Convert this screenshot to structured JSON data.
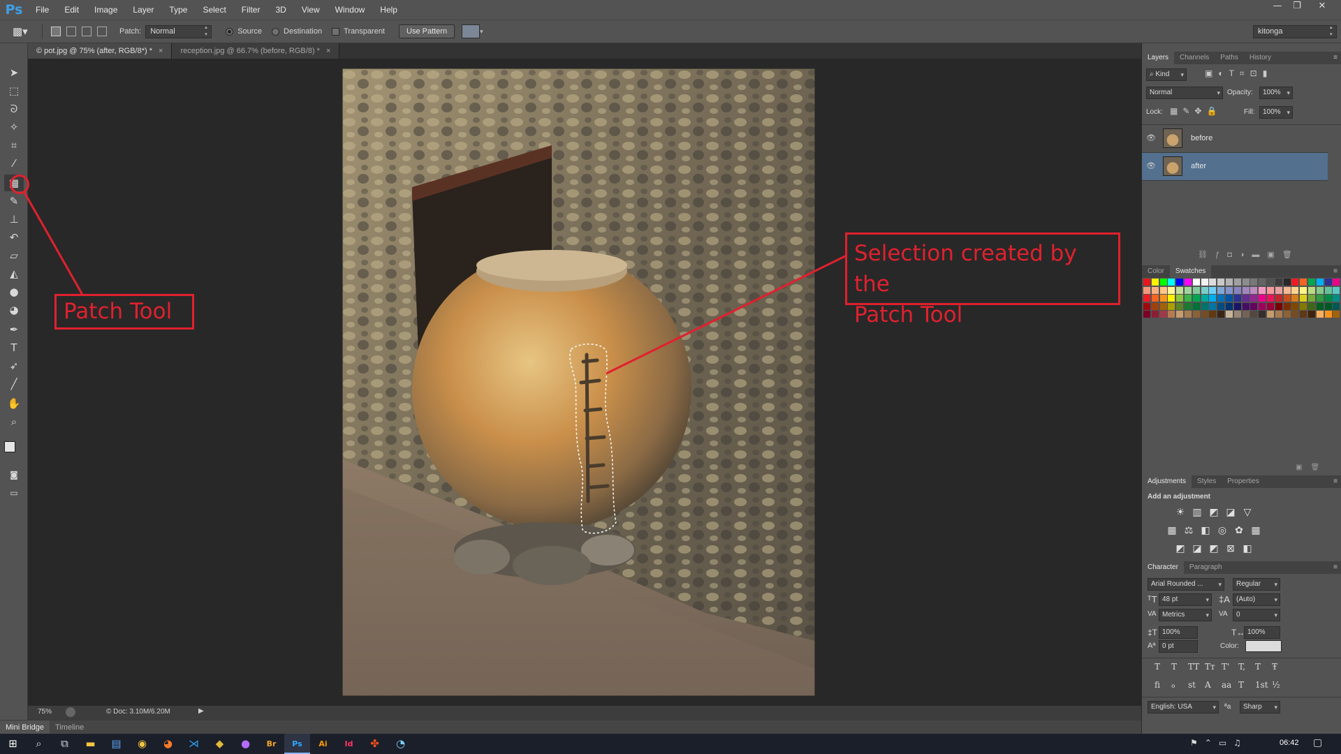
{
  "app": {
    "logo": "Ps",
    "menu": [
      "File",
      "Edit",
      "Image",
      "Layer",
      "Type",
      "Select",
      "Filter",
      "3D",
      "View",
      "Window",
      "Help"
    ],
    "window_controls": [
      "—",
      "❐",
      "✕"
    ]
  },
  "options_bar": {
    "patch_label": "Patch:",
    "patch_mode": "Normal",
    "source_label": "Source",
    "destination_label": "Destination",
    "transparent_label": "Transparent",
    "use_pattern_label": "Use Pattern",
    "workspace": "kitonga",
    "source_selected": true
  },
  "document_tabs": [
    {
      "label": "© pot.jpg @ 75% (after, RGB/8*) *",
      "active": true
    },
    {
      "label": "reception.jpg @ 66.7% (before, RGB/8) *",
      "active": false
    }
  ],
  "toolbar": {
    "active_tool": "patch-tool",
    "tools": [
      {
        "name": "move-tool",
        "glyph": "➤"
      },
      {
        "name": "marquee-tool",
        "glyph": "⬚"
      },
      {
        "name": "lasso-tool",
        "glyph": "ᘐ"
      },
      {
        "name": "magic-wand-tool",
        "glyph": "✧"
      },
      {
        "name": "crop-tool",
        "glyph": "⌗"
      },
      {
        "name": "eyedropper-tool",
        "glyph": "⁄"
      },
      {
        "name": "patch-tool",
        "glyph": "▩"
      },
      {
        "name": "brush-tool",
        "glyph": "✎"
      },
      {
        "name": "clone-stamp-tool",
        "glyph": "⊥"
      },
      {
        "name": "history-brush-tool",
        "glyph": "↶"
      },
      {
        "name": "eraser-tool",
        "glyph": "▱"
      },
      {
        "name": "paint-bucket-tool",
        "glyph": "◭"
      },
      {
        "name": "blur-tool",
        "glyph": "●"
      },
      {
        "name": "dodge-tool",
        "glyph": "◕"
      },
      {
        "name": "pen-tool",
        "glyph": "✒"
      },
      {
        "name": "type-tool",
        "glyph": "T"
      },
      {
        "name": "path-selection-tool",
        "glyph": "➶"
      },
      {
        "name": "line-tool",
        "glyph": "╱"
      },
      {
        "name": "hand-tool",
        "glyph": "✋"
      },
      {
        "name": "zoom-tool",
        "glyph": "🔍"
      }
    ]
  },
  "status_bar": {
    "zoom": "75%",
    "doc_info": "© Doc: 3.10M/6.20M"
  },
  "bottom_tabs": [
    "Mini Bridge",
    "Timeline"
  ],
  "layers_panel": {
    "tabs": [
      "Layers",
      "Channels",
      "Paths",
      "History"
    ],
    "filter_kind": "Kind",
    "blend_mode": "Normal",
    "opacity_label": "Opacity:",
    "opacity_value": "100%",
    "lock_label": "Lock:",
    "fill_label": "Fill:",
    "fill_value": "100%",
    "layers": [
      {
        "name": "before",
        "selected": false
      },
      {
        "name": "after",
        "selected": true
      }
    ]
  },
  "swatches_panel": {
    "tabs": [
      "Color",
      "Swatches"
    ],
    "colors": [
      "#e8161e",
      "#fff200",
      "#00ff00",
      "#00ffff",
      "#0000ff",
      "#ff00ff",
      "#ffffff",
      "#f2f2f2",
      "#dcdcdc",
      "#c8c8c8",
      "#b4b4b4",
      "#a0a0a0",
      "#8c8c8c",
      "#787878",
      "#646464",
      "#505050",
      "#3c3c3c",
      "#282828",
      "#ed1c24",
      "#f26522",
      "#00a651",
      "#00aeef",
      "#2e3192",
      "#ec008c",
      "#f7977a",
      "#f9ad81",
      "#fdc68a",
      "#fff79a",
      "#c4df9b",
      "#a2d39c",
      "#82ca9d",
      "#7bcdc8",
      "#6ecff6",
      "#7ea7d8",
      "#8493ca",
      "#8882be",
      "#a187be",
      "#bc8dbf",
      "#f49ac2",
      "#f6989d",
      "#e8a0a0",
      "#f5b895",
      "#fbd38f",
      "#fff582",
      "#b8db83",
      "#86c98b",
      "#65c19a",
      "#5dc6c4",
      "#ed1c24",
      "#f26522",
      "#f7941d",
      "#fff200",
      "#8dc73f",
      "#39b54a",
      "#00a651",
      "#00a99d",
      "#00aeef",
      "#0072bc",
      "#0054a6",
      "#2e3192",
      "#662d91",
      "#92278f",
      "#ec008c",
      "#ed145b",
      "#c1272d",
      "#c6501e",
      "#d57d1c",
      "#d9cc1c",
      "#74aa3c",
      "#2e9a42",
      "#008c44",
      "#008e84",
      "#9e0b0f",
      "#a0410d",
      "#a36209",
      "#aba000",
      "#598527",
      "#197b30",
      "#007236",
      "#00746b",
      "#0076a3",
      "#004b80",
      "#003471",
      "#1b1464",
      "#440e62",
      "#630460",
      "#9e005d",
      "#9e0039",
      "#790000",
      "#7b2e00",
      "#7d4900",
      "#827b00",
      "#406618",
      "#005e20",
      "#005826",
      "#005952",
      "#7a0026",
      "#8c1d33",
      "#9e3a48",
      "#b8794f",
      "#c69c6d",
      "#a67c52",
      "#8c6239",
      "#754c24",
      "#603913",
      "#3c2415",
      "#c7b299",
      "#998675",
      "#736357",
      "#534741",
      "#362f2d",
      "#c69c6d",
      "#a67c52",
      "#8c6239",
      "#754c24",
      "#603913",
      "#42210b",
      "#fbaf5d",
      "#f7941d",
      "#a3620a"
    ]
  },
  "adjustments_panel": {
    "tabs": [
      "Adjustments",
      "Styles",
      "Properties"
    ],
    "heading": "Add an adjustment",
    "row1": [
      "☀",
      "▥",
      "◩",
      "◪",
      "▽"
    ],
    "row2": [
      "▦",
      "⚖",
      "◧",
      "◎",
      "✿",
      "▦"
    ],
    "row3": [
      "◩",
      "◪",
      "◩",
      "⊠",
      "◧"
    ]
  },
  "character_panel": {
    "tabs": [
      "Character",
      "Paragraph"
    ],
    "font_family": "Arial Rounded ...",
    "font_style": "Regular",
    "size": "48 pt",
    "leading": "(Auto)",
    "kerning": "Metrics",
    "tracking": "0",
    "vscale": "100%",
    "hscale": "100%",
    "baseline": "0 pt",
    "color_label": "Color:",
    "style_buttons": [
      "T",
      "T",
      "TT",
      "Tт",
      "T'",
      "T,",
      "T",
      "Ŧ"
    ],
    "opentype_buttons": [
      "ﬁ",
      "ℴ",
      "st",
      "A",
      "aa",
      "T",
      "1st",
      "½"
    ],
    "language": "English: USA",
    "aa_label": "ªa",
    "antialias": "Sharp"
  },
  "callouts": {
    "patch_tool": "Patch Tool",
    "selection_line1": "Selection created by the",
    "selection_line2": "Patch Tool"
  },
  "taskbar": {
    "time": "06:42",
    "apps": [
      "start",
      "search",
      "task-view",
      "file-explorer",
      "store",
      "chrome",
      "firefox",
      "vscode",
      "git",
      "media",
      "bridge",
      "photoshop",
      "illustrator",
      "indesign",
      "figma",
      "other"
    ]
  }
}
